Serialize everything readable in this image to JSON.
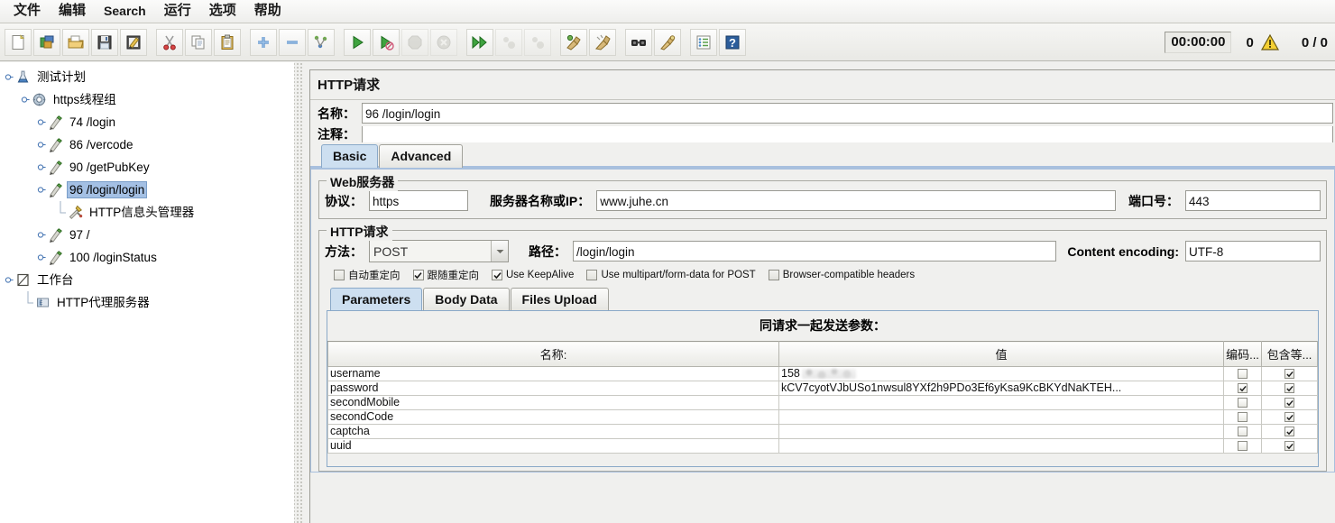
{
  "menu": {
    "items": [
      {
        "label": "文件",
        "latin": false
      },
      {
        "label": "编辑",
        "latin": false
      },
      {
        "label": "Search",
        "latin": true
      },
      {
        "label": "运行",
        "latin": false
      },
      {
        "label": "选项",
        "latin": false
      },
      {
        "label": "帮助",
        "latin": false
      }
    ]
  },
  "toolbar": {
    "buttons": [
      {
        "name": "new-icon",
        "tip": "新建"
      },
      {
        "name": "templates-icon",
        "tip": "模板"
      },
      {
        "name": "open-icon",
        "tip": "打开"
      },
      {
        "name": "save-icon",
        "tip": "保存"
      },
      {
        "name": "save-as-icon",
        "tip": "另存为"
      },
      {
        "name": "cut-icon",
        "tip": "剪切"
      },
      {
        "name": "copy-icon",
        "tip": "复制"
      },
      {
        "name": "paste-icon",
        "tip": "粘贴"
      },
      {
        "name": "expand-all-icon",
        "tip": "展开全部"
      },
      {
        "name": "collapse-all-icon",
        "tip": "折叠全部"
      },
      {
        "name": "toggle-icon",
        "tip": "切换"
      },
      {
        "name": "start-icon",
        "tip": "启动"
      },
      {
        "name": "start-no-pauses-icon",
        "tip": "无停顿启动"
      },
      {
        "name": "stop-icon",
        "tip": "停止"
      },
      {
        "name": "shutdown-icon",
        "tip": "关闭"
      },
      {
        "name": "start-remote-all-icon",
        "tip": "远程全部启动"
      },
      {
        "name": "stop-remote-all-icon",
        "tip": "远程全部停止"
      },
      {
        "name": "shutdown-remote-all-icon",
        "tip": "远程全部关闭"
      },
      {
        "name": "clear-icon",
        "tip": "清除"
      },
      {
        "name": "clear-all-icon",
        "tip": "清除全部"
      },
      {
        "name": "search-icon",
        "tip": "查找"
      },
      {
        "name": "search-reset-icon",
        "tip": "重置查找"
      },
      {
        "name": "function-helper-icon",
        "tip": "函数助手对话框"
      },
      {
        "name": "help-icon",
        "tip": "帮助"
      }
    ],
    "status": {
      "timer": "00:00:00",
      "warnings": "0",
      "warning_icon": "warning-triangle-icon",
      "threads": "0 / 0"
    }
  },
  "tree": {
    "nodes": [
      {
        "label": "测试计划",
        "icon": "test-plan-icon",
        "depth": 0,
        "toggle": "expanded",
        "selected": false
      },
      {
        "label": "https线程组",
        "icon": "thread-group-icon",
        "depth": 1,
        "toggle": "expanded",
        "selected": false
      },
      {
        "label": "74 /login",
        "icon": "http-sampler-icon",
        "depth": 2,
        "toggle": "collapsed",
        "selected": false
      },
      {
        "label": "86 /vercode",
        "icon": "http-sampler-icon",
        "depth": 2,
        "toggle": "collapsed",
        "selected": false
      },
      {
        "label": "90 /getPubKey",
        "icon": "http-sampler-icon",
        "depth": 2,
        "toggle": "collapsed",
        "selected": false
      },
      {
        "label": "96 /login/login",
        "icon": "http-sampler-icon",
        "depth": 2,
        "toggle": "expanded",
        "selected": true
      },
      {
        "label": "HTTP信息头管理器",
        "icon": "header-manager-icon",
        "depth": 3,
        "toggle": "none",
        "selected": false
      },
      {
        "label": "97 /",
        "icon": "http-sampler-icon",
        "depth": 2,
        "toggle": "collapsed",
        "selected": false
      },
      {
        "label": "100 /loginStatus",
        "icon": "http-sampler-icon",
        "depth": 2,
        "toggle": "collapsed",
        "selected": false
      },
      {
        "label": "工作台",
        "icon": "workbench-icon",
        "depth": 0,
        "toggle": "expanded",
        "selected": false
      },
      {
        "label": "HTTP代理服务器",
        "icon": "http-proxy-icon",
        "depth": 1,
        "toggle": "none",
        "selected": false
      }
    ]
  },
  "panel": {
    "title": "HTTP请求",
    "name_label": "名称：",
    "name_value": "96 /login/login",
    "comment_label": "注释：",
    "comment_value": "",
    "tabs": [
      {
        "label": "Basic",
        "active": true
      },
      {
        "label": "Advanced",
        "active": false
      }
    ],
    "web_server": {
      "group_title": "Web服务器",
      "protocol_label": "协议：",
      "protocol_value": "https",
      "server_label": "服务器名称或IP：",
      "server_value": "www.juhe.cn",
      "port_label": "端口号：",
      "port_value": "443"
    },
    "http_request": {
      "group_title": "HTTP请求",
      "method_label": "方法：",
      "method_value": "POST",
      "path_label": "路径：",
      "path_value": "/login/login",
      "encoding_label": "Content encoding:",
      "encoding_value": "UTF-8",
      "checkboxes": [
        {
          "label": "自动重定向",
          "checked": false
        },
        {
          "label": "跟随重定向",
          "checked": true
        },
        {
          "label": "Use KeepAlive",
          "checked": true
        },
        {
          "label": "Use multipart/form-data for POST",
          "checked": false
        },
        {
          "label": "Browser-compatible headers",
          "checked": false
        }
      ]
    },
    "param_tabs": [
      {
        "label": "Parameters",
        "active": true
      },
      {
        "label": "Body Data",
        "active": false
      },
      {
        "label": "Files Upload",
        "active": false
      }
    ],
    "params": {
      "caption": "同请求一起发送参数：",
      "columns": [
        "名称:",
        "值",
        "编码...",
        "包含等..."
      ],
      "rows": [
        {
          "name": "username",
          "value": "158",
          "value_redacted": true,
          "encode": false,
          "include": true
        },
        {
          "name": "password",
          "value": "kCV7cyotVJbUSo1nwsul8YXf2h9PDo3Ef6yKsa9KcBKYdNaKTEH...",
          "value_redacted": false,
          "encode": true,
          "include": true
        },
        {
          "name": "secondMobile",
          "value": "",
          "value_redacted": false,
          "encode": false,
          "include": true
        },
        {
          "name": "secondCode",
          "value": "",
          "value_redacted": false,
          "encode": false,
          "include": true
        },
        {
          "name": "captcha",
          "value": "",
          "value_redacted": false,
          "encode": false,
          "include": true
        },
        {
          "name": "uuid",
          "value": "",
          "value_redacted": false,
          "encode": false,
          "include": true
        }
      ]
    }
  },
  "colors": {
    "selection": "#a4c0e4",
    "tab_active": "#cddff0",
    "panel_bg": "#f0f0ee",
    "warning": "#f5d033"
  }
}
